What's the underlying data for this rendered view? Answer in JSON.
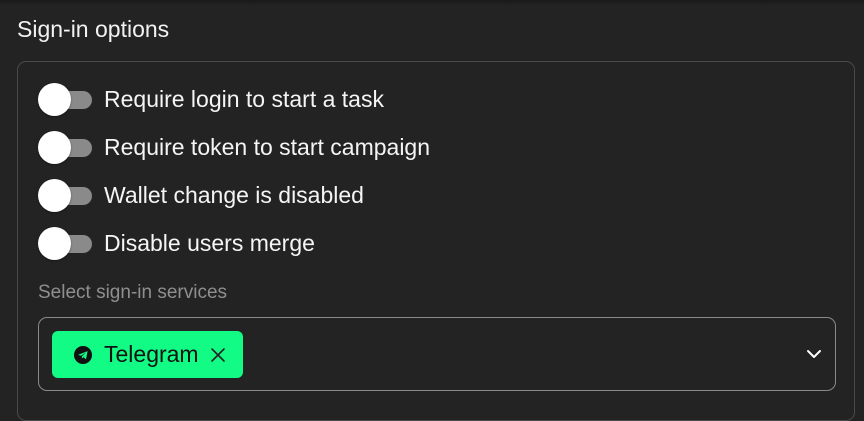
{
  "section": {
    "title": "Sign-in options"
  },
  "toggles": [
    {
      "label": "Require login to start a task",
      "enabled": false
    },
    {
      "label": "Require token to start campaign",
      "enabled": false
    },
    {
      "label": "Wallet change is disabled",
      "enabled": false
    },
    {
      "label": "Disable users merge",
      "enabled": false
    }
  ],
  "services": {
    "label": "Select sign-in services",
    "selected": [
      {
        "label": "Telegram",
        "icon": "telegram-icon"
      }
    ],
    "dropdown_icon": "chevron-down-icon"
  },
  "colors": {
    "background": "#232323",
    "chip": "#12fc85",
    "toggle_track_off": "#8a8a8a",
    "toggle_thumb": "#ffffff",
    "muted_text": "#8f8f8f"
  }
}
